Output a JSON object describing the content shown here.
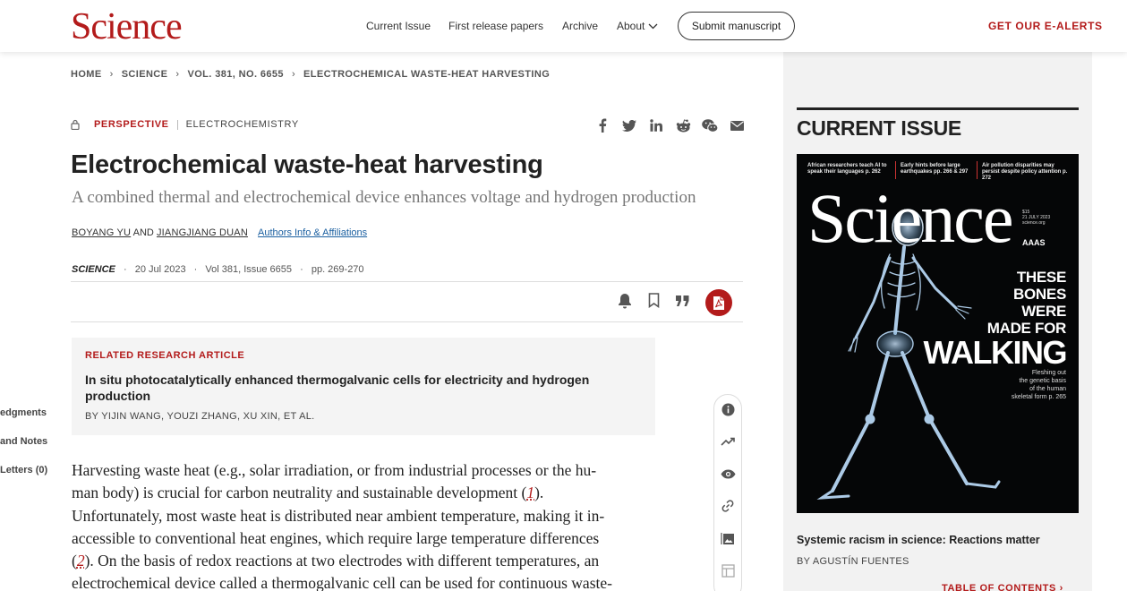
{
  "header": {
    "logo": "Science",
    "nav": [
      "Current Issue",
      "First release papers",
      "Archive",
      "About"
    ],
    "submit_label": "Submit manuscript",
    "alerts_label": "GET OUR E-ALERTS"
  },
  "breadcrumb": [
    "HOME",
    "SCIENCE",
    "VOL. 381, NO. 6655",
    "ELECTROCHEMICAL WASTE-HEAT HARVESTING"
  ],
  "article": {
    "type": "PERSPECTIVE",
    "subject": "ELECTROCHEMISTRY",
    "title": "Electrochemical waste-heat harvesting",
    "subtitle": "A combined thermal and electrochemical device enhances voltage and hydrogen production",
    "authors": [
      "BOYANG YU",
      "JIANGJIANG DUAN"
    ],
    "authors_joiner": "AND",
    "affiliations_label": "Authors Info & Affiliations",
    "journal": "SCIENCE",
    "date": "20 Jul 2023",
    "volume": "Vol 381, Issue 6655",
    "pages": "pp. 269-270"
  },
  "share_icons": [
    "facebook-icon",
    "twitter-icon",
    "linkedin-icon",
    "reddit-icon",
    "wechat-icon",
    "email-icon"
  ],
  "related": {
    "label": "RELATED RESEARCH ARTICLE",
    "title": "In situ photocatalytically enhanced thermogalvanic cells for electricity and hydrogen production",
    "authors": "BY YIJIN WANG, YOUZI ZHANG, XU XIN, ET AL."
  },
  "left_sidebar": [
    "edgments",
    "and Notes",
    "Letters (0)"
  ],
  "body": {
    "p1": "Harvesting waste heat (e.g., solar irradiation, or from industrial processes or the hu-",
    "p2a": "man body) is crucial for carbon neutrality and sustainable development (",
    "ref1": "1",
    "p2b": ").",
    "p3": "Unfortunately, most waste heat is distributed near ambient temperature, making it in-",
    "p4": "accessible to conventional heat engines, which require large temperature differences",
    "p5a": "(",
    "ref2": "2",
    "p5b": "). On the basis of redox reactions at two electrodes with different temperatures, an",
    "p6": "electrochemical device called a thermogalvanic cell can be used for continuous waste-"
  },
  "current_issue": {
    "heading": "CURRENT ISSUE",
    "cover": {
      "teasers": [
        "African researchers teach AI to speak their languages p. 262",
        "Early hints before large earthquakes pp. 266 & 297",
        "Air pollution disparities may persist despite policy attention p. 272"
      ],
      "masthead": "Science",
      "price": "$15",
      "issue_date": "21 JULY 2023",
      "site": "science.org",
      "publisher": "AAAS",
      "headline_lines": [
        "THESE",
        "BONES",
        "WERE",
        "MADE FOR"
      ],
      "headline_big": "WALKING",
      "blurb_lines": [
        "Fleshing out",
        "the genetic basis",
        "of the human",
        "skeletal form p. 265"
      ]
    },
    "caption": "Systemic racism in science: Reactions matter",
    "byline": "BY AGUSTÍN FUENTES",
    "toc_label": "TABLE OF CONTENTS"
  }
}
